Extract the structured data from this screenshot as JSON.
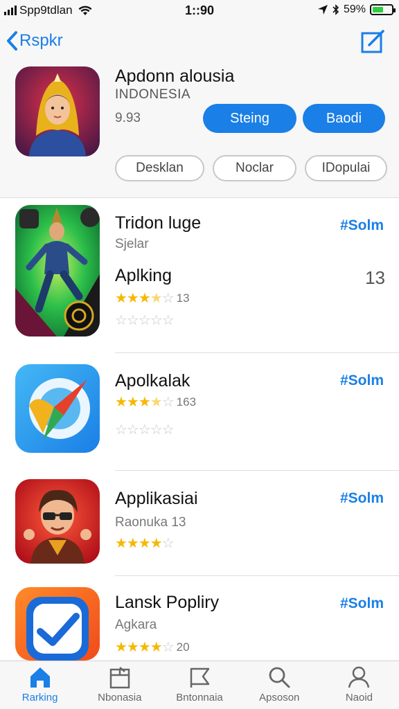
{
  "status_bar": {
    "carrier": "Spp9tdlan",
    "time": "1::90",
    "battery": "59%",
    "battery_level": 0.59
  },
  "nav": {
    "back_label": "Rspkr",
    "back_icon": "chevron-left-icon",
    "edit_icon": "compose-icon"
  },
  "featured": {
    "title": "Apdonn alousia",
    "subtitle": "INDONESIA",
    "meta": "9.93",
    "primary_buttons": [
      "Steing",
      "Baodi"
    ],
    "filter_buttons": [
      "Desklan",
      "Noclar",
      "IDopulai"
    ]
  },
  "apps": [
    {
      "name": "Tridon luge",
      "subtitle": "Sjelar",
      "price": "#Solm",
      "secondary_name": "Aplking",
      "rating_count": "13",
      "rank": "13",
      "rating": 3.5
    },
    {
      "name": "Apolkalak",
      "price": "#Solm",
      "rating_count": "163",
      "rating": 3.5
    },
    {
      "name": "Applikasiai",
      "subtitle": "Raonuka 13",
      "price": "#Solm",
      "rating": 4
    },
    {
      "name": "Lansk Popliry",
      "subtitle": "Agkara",
      "price": "#Solm",
      "rating_count": "20",
      "rating": 4
    }
  ],
  "tabs": [
    {
      "label": "Rarking",
      "icon": "home-icon",
      "active": true
    },
    {
      "label": "Nbonasia",
      "icon": "categories-icon",
      "active": false
    },
    {
      "label": "Bntonnaia",
      "icon": "flag-icon",
      "active": false
    },
    {
      "label": "Apsoson",
      "icon": "search-icon",
      "active": false
    },
    {
      "label": "Naoid",
      "icon": "profile-icon",
      "active": false
    }
  ],
  "colors": {
    "accent": "#1a7fe6",
    "star": "#f5b800",
    "background": "#f7f7f7"
  }
}
